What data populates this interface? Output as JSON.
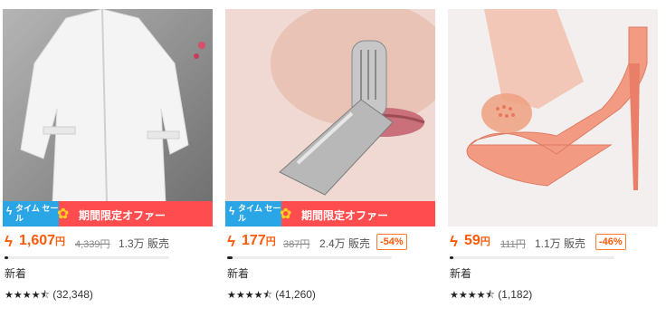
{
  "products": [
    {
      "image_alt": "white blouse",
      "banner": {
        "badge": "タイム セール",
        "text": "期間限定オファー"
      },
      "price": "1,607",
      "currency": "円",
      "original_price": "4,339円",
      "sold": "1.3万 販売",
      "discount": "",
      "tag": "新着",
      "rating": 4.5,
      "reviews": "(32,348)",
      "sales_progress": 0.02
    },
    {
      "image_alt": "nose hair trimmer",
      "banner": {
        "badge": "タイム セール",
        "text": "期間限定オファー"
      },
      "price": "177",
      "currency": "円",
      "original_price": "387円",
      "sold": "2.4万 販売",
      "discount": "-54%",
      "tag": "新着",
      "rating": 4.5,
      "reviews": "(41,260)",
      "sales_progress": 0.03
    },
    {
      "image_alt": "forefoot pad in pink heel",
      "banner": null,
      "price": "59",
      "currency": "円",
      "original_price": "111円",
      "sold": "1.1万 販売",
      "discount": "-46%",
      "tag": "新着",
      "rating": 4.5,
      "reviews": "(1,182)",
      "sales_progress": 0.02
    }
  ],
  "colors": {
    "price": "#ff5a0a",
    "banner": "#ff4d4f",
    "badge": "#2aa6e6"
  }
}
